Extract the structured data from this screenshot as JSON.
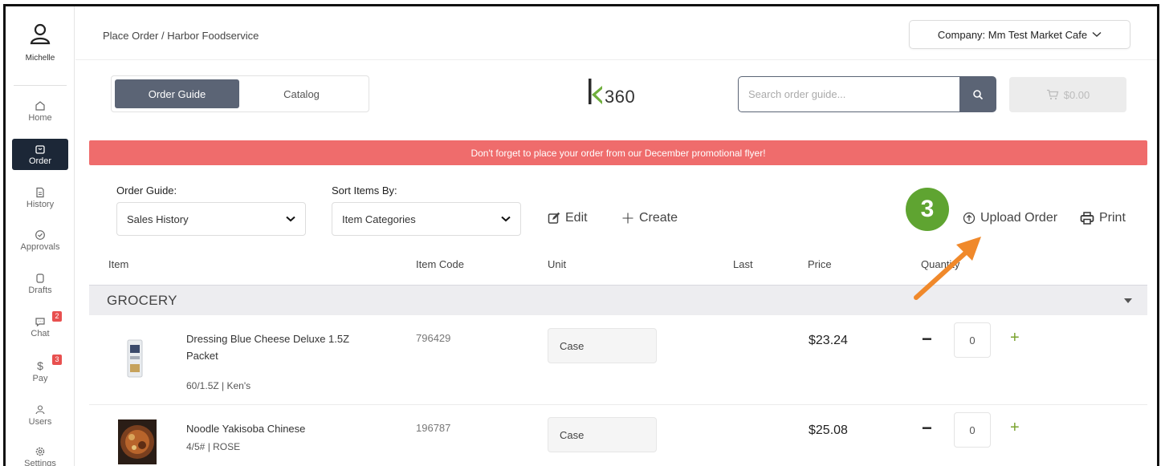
{
  "user": {
    "name": "Michelle"
  },
  "nav": [
    {
      "label": "Home",
      "icon": "home-icon"
    },
    {
      "label": "Order",
      "icon": "order-icon",
      "active": true
    },
    {
      "label": "History",
      "icon": "history-icon"
    },
    {
      "label": "Approvals",
      "icon": "approvals-icon"
    },
    {
      "label": "Drafts",
      "icon": "drafts-icon"
    },
    {
      "label": "Chat",
      "icon": "chat-icon",
      "badge": "2"
    },
    {
      "label": "Pay",
      "icon": "dollar-icon",
      "badge": "3"
    },
    {
      "label": "Users",
      "icon": "users-icon"
    },
    {
      "label": "Settings",
      "icon": "gear-icon"
    }
  ],
  "breadcrumb": "Place Order / Harbor Foodservice",
  "company": {
    "label": "Company: Mm Test Market Cafe"
  },
  "tabs": [
    {
      "label": "Order Guide",
      "active": true
    },
    {
      "label": "Catalog"
    }
  ],
  "logo": {
    "text": "360"
  },
  "search": {
    "placeholder": "Search order guide..."
  },
  "cart": {
    "total": "$0.00"
  },
  "promo": "Don't forget to place your order from our December promotional flyer!",
  "filters": {
    "order_guide_label": "Order Guide:",
    "order_guide_value": "Sales History",
    "sort_label": "Sort Items By:",
    "sort_value": "Item Categories"
  },
  "actions": {
    "edit": "Edit",
    "create": "Create",
    "upload": "Upload Order",
    "print": "Print"
  },
  "step": "3",
  "columns": {
    "item": "Item",
    "code": "Item Code",
    "unit": "Unit",
    "last": "Last",
    "price": "Price",
    "quantity": "Quantity"
  },
  "group": {
    "name": "GROCERY"
  },
  "items": [
    {
      "name_line1": "Dressing Blue Cheese Deluxe 1.5Z",
      "name_line2": "Packet",
      "meta": "60/1.5Z | Ken's",
      "code": "796429",
      "unit": "Case",
      "price": "$23.24",
      "qty": "0"
    },
    {
      "name_line1": "Noodle Yakisoba Chinese",
      "name_line2": "",
      "meta": "4/5# | ROSE",
      "code": "196787",
      "unit": "Case",
      "price": "$25.08",
      "qty": "0"
    }
  ],
  "colors": {
    "accent": "#5b6475",
    "promo": "#ef6c6c",
    "step": "#5fa431",
    "arrow": "#f0892b",
    "navActive": "#1c2737"
  }
}
